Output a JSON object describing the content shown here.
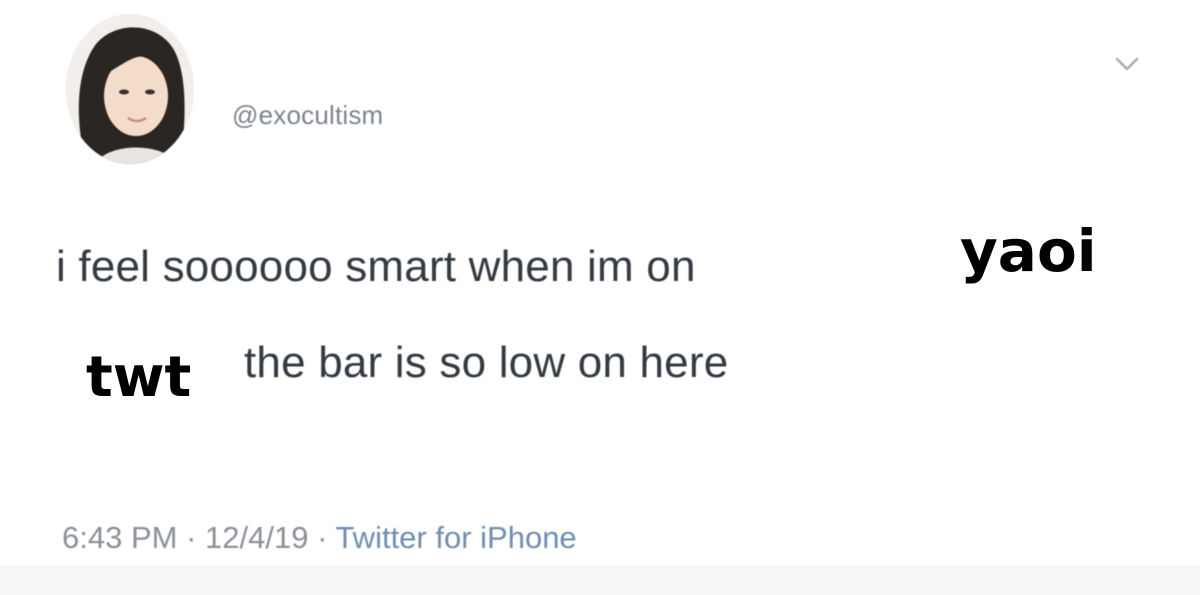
{
  "tweet": {
    "handle": "@exocultism",
    "text_line_1": "i feel soooooo smart when im on",
    "text_line_2": "the bar is so low on here",
    "meta": {
      "time": "6:43 PM",
      "separator": " · ",
      "date": "12/4/19",
      "source": "Twitter for iPhone"
    }
  },
  "overlays": {
    "word_1": "yaoi",
    "word_2": "twt"
  },
  "icons": {
    "menu": "chevron-down-icon",
    "avatar": "profile-avatar"
  },
  "colors": {
    "text": "#333a42",
    "secondary": "#8a9098",
    "link": "#6f8db0",
    "overlay": "#000000"
  }
}
